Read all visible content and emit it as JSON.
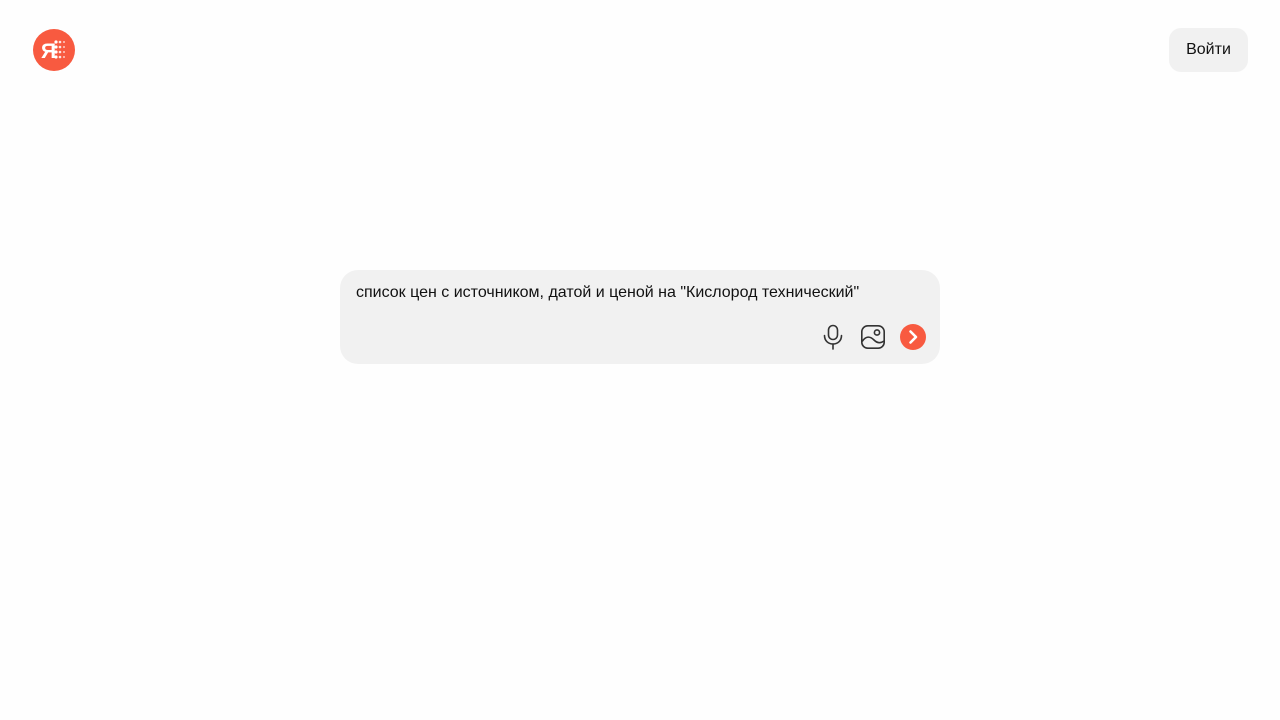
{
  "header": {
    "logo_icon": "yandex-alice-logo-icon",
    "logo_color": "#f85a40",
    "login_label": "Войти"
  },
  "search": {
    "query": "список цен с источником, датой и ценой на \"Кислород технический\"",
    "voice_icon": "microphone-icon",
    "image_icon": "image-search-icon",
    "send_icon": "chevron-right-icon",
    "send_color": "#f85a40"
  }
}
